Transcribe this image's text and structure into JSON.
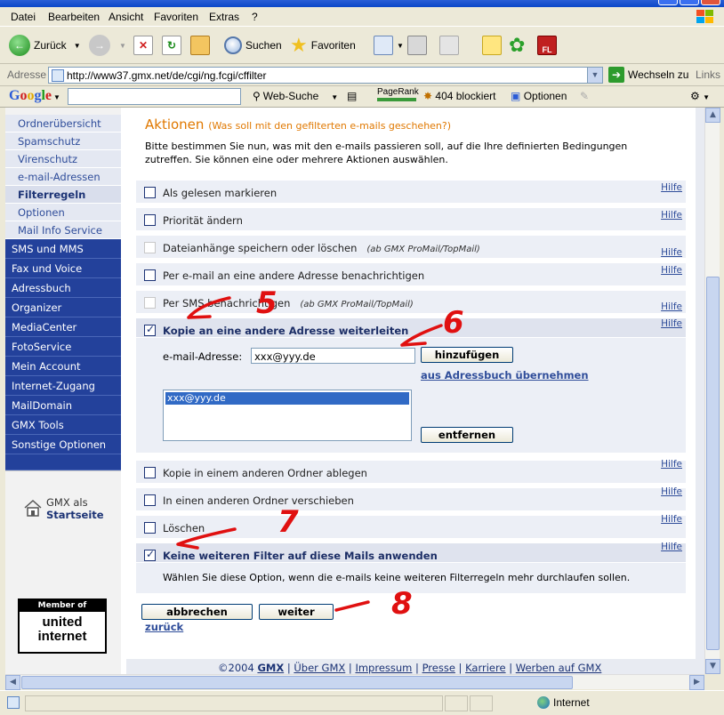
{
  "menu": [
    "Datei",
    "Bearbeiten",
    "Ansicht",
    "Favoriten",
    "Extras",
    "?"
  ],
  "toolbar": {
    "back": "Zurück",
    "search": "Suchen",
    "favorites": "Favoriten"
  },
  "address": {
    "label": "Adresse",
    "url": "http://www37.gmx.net/de/cgi/ng.fcgi/cffilter",
    "go": "Wechseln zu",
    "links": "Links"
  },
  "googlebar": {
    "websearch": "Web-Suche",
    "pagerank": "PageRank",
    "blocked": "404 blockiert",
    "options": "Optionen"
  },
  "sidebar": {
    "sub_items": [
      "Ordnerübersicht",
      "Spamschutz",
      "Virenschutz",
      "e-mail-Adressen",
      "Filterregeln",
      "Optionen",
      "Mail Info Service"
    ],
    "main_items": [
      "SMS und MMS",
      "Fax und Voice",
      "Adressbuch",
      "Organizer",
      "MediaCenter",
      "FotoService",
      "Mein Account",
      "Internet-Zugang",
      "MailDomain",
      "GMX Tools",
      "Sonstige Optionen"
    ],
    "gmx_start_line1": "GMX als",
    "gmx_start_line2": "Startseite",
    "member_top": "Member of",
    "member_l1": "united",
    "member_l2": "internet"
  },
  "content": {
    "heading": "Aktionen",
    "heading_sub": "(Was soll mit den gefilterten e-mails geschehen?)",
    "intro": "Bitte bestimmen Sie nun, was mit den e-mails passieren soll, auf die Ihre definierten Bedingungen zutreffen. Sie können eine oder mehrere Aktionen auswählen.",
    "help": "Hilfe",
    "actions": [
      {
        "label": "Als gelesen markieren",
        "note": ""
      },
      {
        "label": "Priorität ändern",
        "note": ""
      },
      {
        "label": "Dateianhänge speichern oder löschen",
        "note": "(ab GMX ProMail/TopMail)"
      },
      {
        "label": "Per e-mail an eine andere Adresse benachrichtigen",
        "note": ""
      },
      {
        "label": "Per SMS benachrichtigen",
        "note": "(ab GMX ProMail/TopMail)"
      },
      {
        "label": "Kopie an eine andere Adresse weiterleiten",
        "note": ""
      },
      {
        "label": "Kopie in einem anderen Ordner ablegen",
        "note": ""
      },
      {
        "label": "In einen anderen Ordner verschieben",
        "note": ""
      },
      {
        "label": "Löschen",
        "note": ""
      },
      {
        "label": "Keine weiteren Filter auf diese Mails anwenden",
        "note": ""
      }
    ],
    "email_label": "e-mail-Adresse:",
    "email_value": "xxx@yyy.de",
    "add_button": "hinzufügen",
    "from_addressbook": "aus Adressbuch übernehmen",
    "list_items": [
      "xxx@yyy.de"
    ],
    "remove_button": "entfernen",
    "no_filter_desc": "Wählen Sie diese Option, wenn die e-mails keine weiteren Filterregeln mehr durchlaufen sollen.",
    "cancel_button": "abbrechen",
    "next_button": "weiter",
    "back_link": "zurück"
  },
  "footer": {
    "copyright": "©2004",
    "gmx": "GMX",
    "links": [
      "Über GMX",
      "Impressum",
      "Presse",
      "Karriere",
      "Werben auf GMX"
    ]
  },
  "status": {
    "zone": "Internet"
  },
  "annotations": [
    "5",
    "6",
    "7",
    "8"
  ]
}
